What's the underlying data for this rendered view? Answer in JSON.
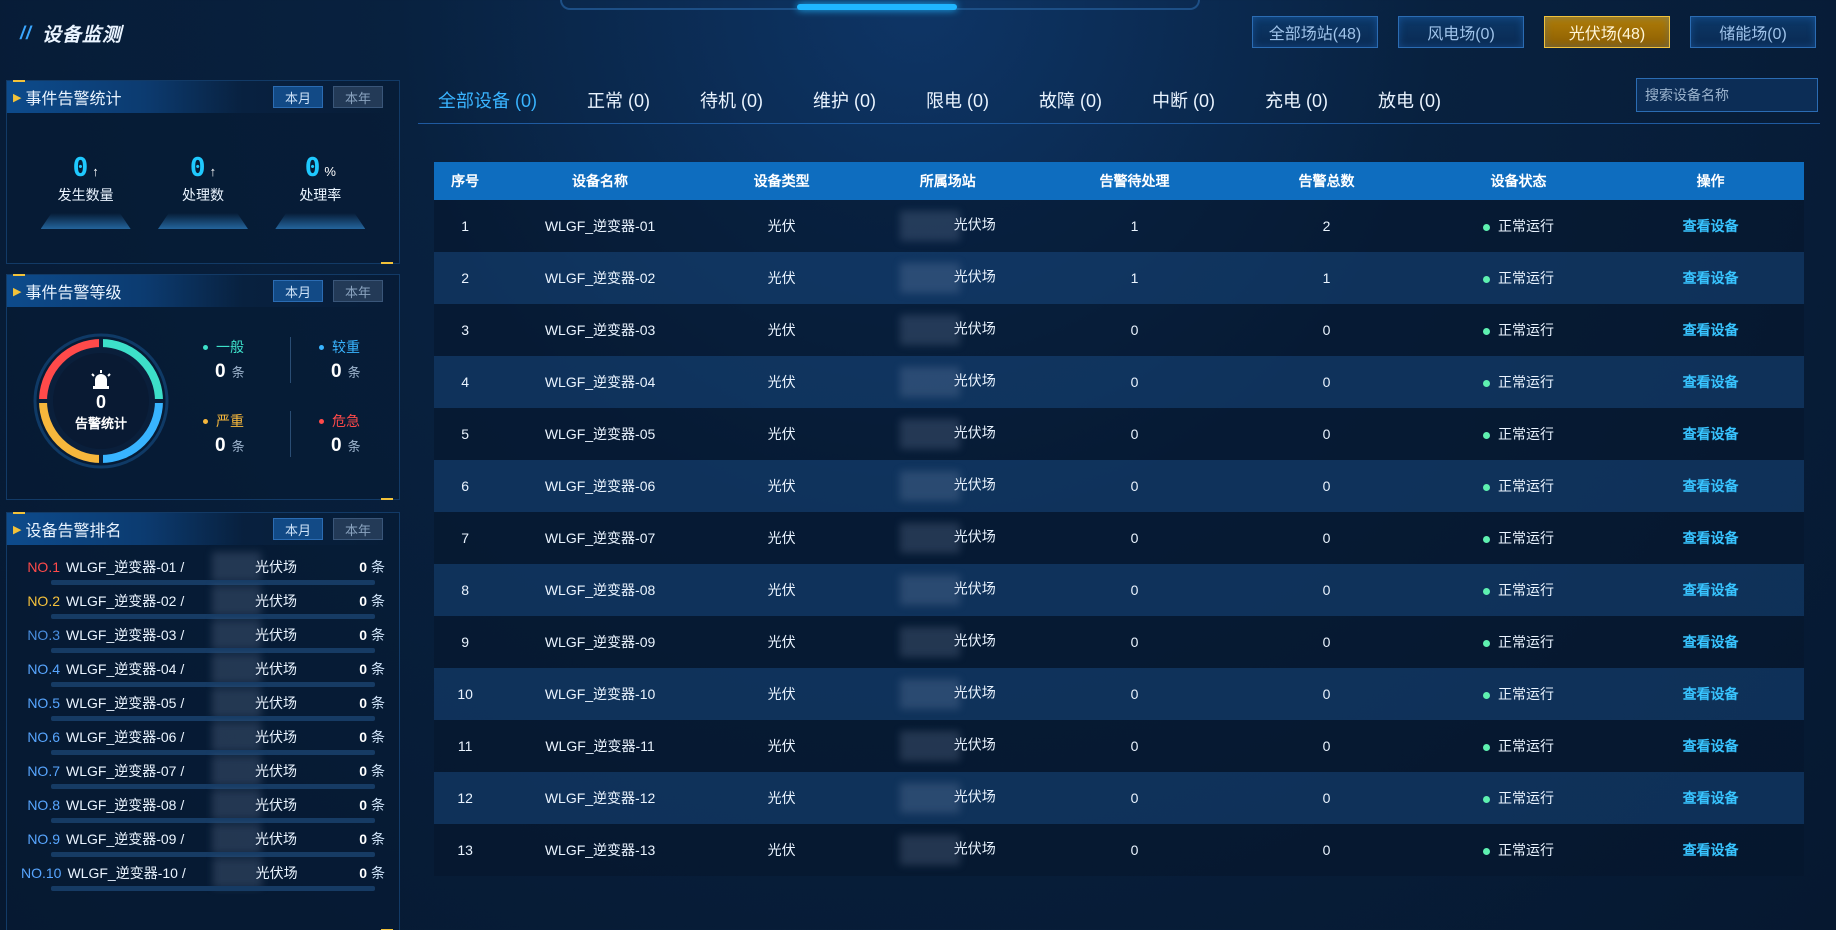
{
  "app": {
    "title": "设备监测"
  },
  "site_filters": [
    {
      "label": "全部场站(48)",
      "active": false
    },
    {
      "label": "风电场(0)",
      "active": false
    },
    {
      "label": "光伏场(48)",
      "active": true
    },
    {
      "label": "储能场(0)",
      "active": false
    }
  ],
  "panels": {
    "stats": {
      "title": "事件告警统计",
      "tab_month": "本月",
      "tab_year": "本年",
      "items": [
        {
          "value": "0",
          "unit": "↑",
          "label": "发生数量"
        },
        {
          "value": "0",
          "unit": "↑",
          "label": "处理数"
        },
        {
          "value": "0",
          "unit": "%",
          "label": "处理率"
        }
      ]
    },
    "levels": {
      "title": "事件告警等级",
      "tab_month": "本月",
      "tab_year": "本年",
      "total": "0",
      "total_label": "告警统计",
      "items": [
        {
          "name": "一般",
          "count": "0",
          "unit": "条",
          "color": "#3de0c9"
        },
        {
          "name": "较重",
          "count": "0",
          "unit": "条",
          "color": "#38b4ff"
        },
        {
          "name": "严重",
          "count": "0",
          "unit": "条",
          "color": "#f6b73c"
        },
        {
          "name": "危急",
          "count": "0",
          "unit": "条",
          "color": "#ff4a4a"
        }
      ]
    },
    "ranking": {
      "title": "设备告警排名",
      "tab_month": "本月",
      "tab_year": "本年",
      "items": [
        {
          "no": "NO.1",
          "name": "WLGF_逆变器-01 /",
          "site": "光伏场",
          "count": "0",
          "unit": "条"
        },
        {
          "no": "NO.2",
          "name": "WLGF_逆变器-02 /",
          "site": "光伏场",
          "count": "0",
          "unit": "条"
        },
        {
          "no": "NO.3",
          "name": "WLGF_逆变器-03 /",
          "site": "光伏场",
          "count": "0",
          "unit": "条"
        },
        {
          "no": "NO.4",
          "name": "WLGF_逆变器-04 /",
          "site": "光伏场",
          "count": "0",
          "unit": "条"
        },
        {
          "no": "NO.5",
          "name": "WLGF_逆变器-05 /",
          "site": "光伏场",
          "count": "0",
          "unit": "条"
        },
        {
          "no": "NO.6",
          "name": "WLGF_逆变器-06 /",
          "site": "光伏场",
          "count": "0",
          "unit": "条"
        },
        {
          "no": "NO.7",
          "name": "WLGF_逆变器-07 /",
          "site": "光伏场",
          "count": "0",
          "unit": "条"
        },
        {
          "no": "NO.8",
          "name": "WLGF_逆变器-08 /",
          "site": "光伏场",
          "count": "0",
          "unit": "条"
        },
        {
          "no": "NO.9",
          "name": "WLGF_逆变器-09 /",
          "site": "光伏场",
          "count": "0",
          "unit": "条"
        },
        {
          "no": "NO.10",
          "name": "WLGF_逆变器-10 /",
          "site": "光伏场",
          "count": "0",
          "unit": "条"
        }
      ]
    }
  },
  "status_tabs": [
    {
      "label": "全部设备 (0)",
      "active": true
    },
    {
      "label": "正常 (0)",
      "active": false
    },
    {
      "label": "待机 (0)",
      "active": false
    },
    {
      "label": "维护 (0)",
      "active": false
    },
    {
      "label": "限电 (0)",
      "active": false
    },
    {
      "label": "故障 (0)",
      "active": false
    },
    {
      "label": "中断 (0)",
      "active": false
    },
    {
      "label": "充电 (0)",
      "active": false
    },
    {
      "label": "放电 (0)",
      "active": false
    }
  ],
  "search": {
    "placeholder": "搜索设备名称"
  },
  "table": {
    "columns": [
      "序号",
      "设备名称",
      "设备类型",
      "所属场站",
      "告警待处理",
      "告警总数",
      "设备状态",
      "操作"
    ],
    "rows": [
      {
        "no": "1",
        "name": "WLGF_逆变器-01",
        "type": "光伏",
        "site": "光伏场",
        "pending": "1",
        "total": "2",
        "status": "正常运行",
        "action": "查看设备"
      },
      {
        "no": "2",
        "name": "WLGF_逆变器-02",
        "type": "光伏",
        "site": "光伏场",
        "pending": "1",
        "total": "1",
        "status": "正常运行",
        "action": "查看设备"
      },
      {
        "no": "3",
        "name": "WLGF_逆变器-03",
        "type": "光伏",
        "site": "光伏场",
        "pending": "0",
        "total": "0",
        "status": "正常运行",
        "action": "查看设备"
      },
      {
        "no": "4",
        "name": "WLGF_逆变器-04",
        "type": "光伏",
        "site": "光伏场",
        "pending": "0",
        "total": "0",
        "status": "正常运行",
        "action": "查看设备"
      },
      {
        "no": "5",
        "name": "WLGF_逆变器-05",
        "type": "光伏",
        "site": "光伏场",
        "pending": "0",
        "total": "0",
        "status": "正常运行",
        "action": "查看设备"
      },
      {
        "no": "6",
        "name": "WLGF_逆变器-06",
        "type": "光伏",
        "site": "光伏场",
        "pending": "0",
        "total": "0",
        "status": "正常运行",
        "action": "查看设备"
      },
      {
        "no": "7",
        "name": "WLGF_逆变器-07",
        "type": "光伏",
        "site": "光伏场",
        "pending": "0",
        "total": "0",
        "status": "正常运行",
        "action": "查看设备"
      },
      {
        "no": "8",
        "name": "WLGF_逆变器-08",
        "type": "光伏",
        "site": "光伏场",
        "pending": "0",
        "total": "0",
        "status": "正常运行",
        "action": "查看设备"
      },
      {
        "no": "9",
        "name": "WLGF_逆变器-09",
        "type": "光伏",
        "site": "光伏场",
        "pending": "0",
        "total": "0",
        "status": "正常运行",
        "action": "查看设备"
      },
      {
        "no": "10",
        "name": "WLGF_逆变器-10",
        "type": "光伏",
        "site": "光伏场",
        "pending": "0",
        "total": "0",
        "status": "正常运行",
        "action": "查看设备"
      },
      {
        "no": "11",
        "name": "WLGF_逆变器-11",
        "type": "光伏",
        "site": "光伏场",
        "pending": "0",
        "total": "0",
        "status": "正常运行",
        "action": "查看设备"
      },
      {
        "no": "12",
        "name": "WLGF_逆变器-12",
        "type": "光伏",
        "site": "光伏场",
        "pending": "0",
        "total": "0",
        "status": "正常运行",
        "action": "查看设备"
      },
      {
        "no": "13",
        "name": "WLGF_逆变器-13",
        "type": "光伏",
        "site": "光伏场",
        "pending": "0",
        "total": "0",
        "status": "正常运行",
        "action": "查看设备"
      }
    ]
  }
}
